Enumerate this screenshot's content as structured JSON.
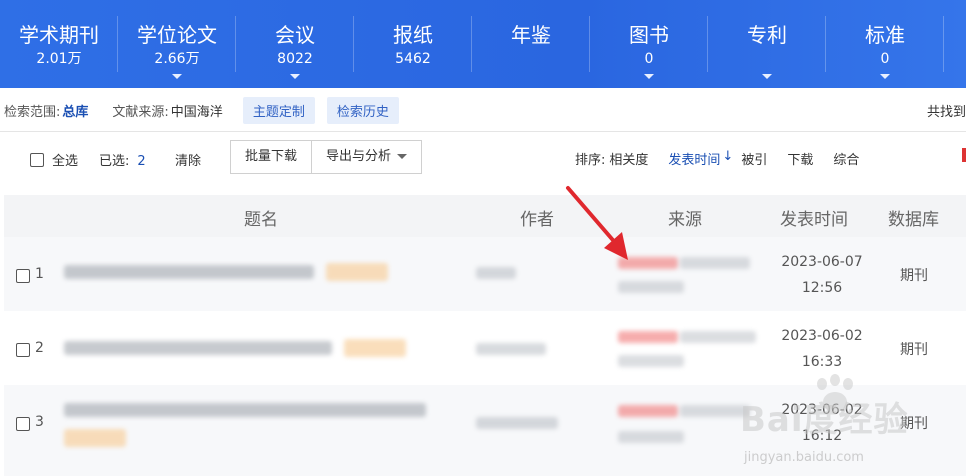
{
  "nav": {
    "items": [
      {
        "label": "学术期刊",
        "count": "2.01万",
        "caret": false
      },
      {
        "label": "学位论文",
        "count": "2.66万",
        "caret": true
      },
      {
        "label": "会议",
        "count": "8022",
        "caret": true
      },
      {
        "label": "报纸",
        "count": "5462",
        "caret": false
      },
      {
        "label": "年鉴",
        "count": "",
        "caret": false
      },
      {
        "label": "图书",
        "count": "0",
        "caret": true
      },
      {
        "label": "专利",
        "count": "",
        "caret": true
      },
      {
        "label": "标准",
        "count": "0",
        "caret": true
      }
    ]
  },
  "scope": {
    "range_label": "检索范围:",
    "range_value": "总库",
    "source_label": "文献来源:",
    "source_value": "中国海洋",
    "topic_button": "主题定制",
    "history_button": "检索历史",
    "total_text": "共找到"
  },
  "toolbar": {
    "select_all": "全选",
    "selected_label": "已选:",
    "selected_count": "2",
    "clear": "清除",
    "batch_download": "批量下载",
    "export_analysis": "导出与分析",
    "sort_label": "排序:",
    "sort_relevance": "相关度",
    "sort_pubtime": "发表时间",
    "sort_arrow": "↓",
    "sort_cited": "被引",
    "sort_download": "下载",
    "sort_composite": "综合"
  },
  "table": {
    "headers": {
      "title": "题名",
      "author": "作者",
      "source": "来源",
      "pubtime": "发表时间",
      "database": "数据库"
    },
    "rows": [
      {
        "index": "1",
        "date": "2023-06-07",
        "time": "12:56",
        "db": "期刊"
      },
      {
        "index": "2",
        "date": "2023-06-02",
        "time": "16:33",
        "db": "期刊"
      },
      {
        "index": "3",
        "date": "2023-06-02",
        "time": "16:12",
        "db": "期刊"
      }
    ]
  },
  "watermark": {
    "brand": "Bai度经验",
    "url": "jingyan.baidu.com"
  },
  "colors": {
    "nav_bg": "#2f6fe6",
    "link_blue": "#1a4fb3",
    "annotation_red": "#e0282e"
  }
}
